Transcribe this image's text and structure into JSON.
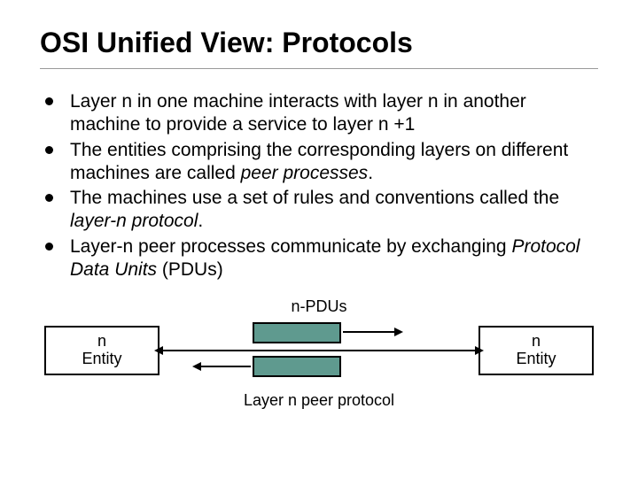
{
  "title": "OSI Unified View: Protocols",
  "bullets": [
    {
      "pre": "Layer n in one machine interacts with layer n in another machine to provide a service to layer n +1",
      "em": "",
      "post": ""
    },
    {
      "pre": "The entities comprising the corresponding layers on different machines are called ",
      "em": "peer processes",
      "post": "."
    },
    {
      "pre": "The machines use a set of rules and conventions called the ",
      "em": "layer-n protocol",
      "post": "."
    },
    {
      "pre": "Layer-n peer processes communicate by exchanging ",
      "em": "Protocol Data Units",
      "post": " (PDUs)"
    }
  ],
  "diagram": {
    "pdu_label": "n-PDUs",
    "entity_left": "n\nEntity",
    "entity_right": "n\nEntity",
    "protocol_label": "Layer n peer protocol"
  }
}
